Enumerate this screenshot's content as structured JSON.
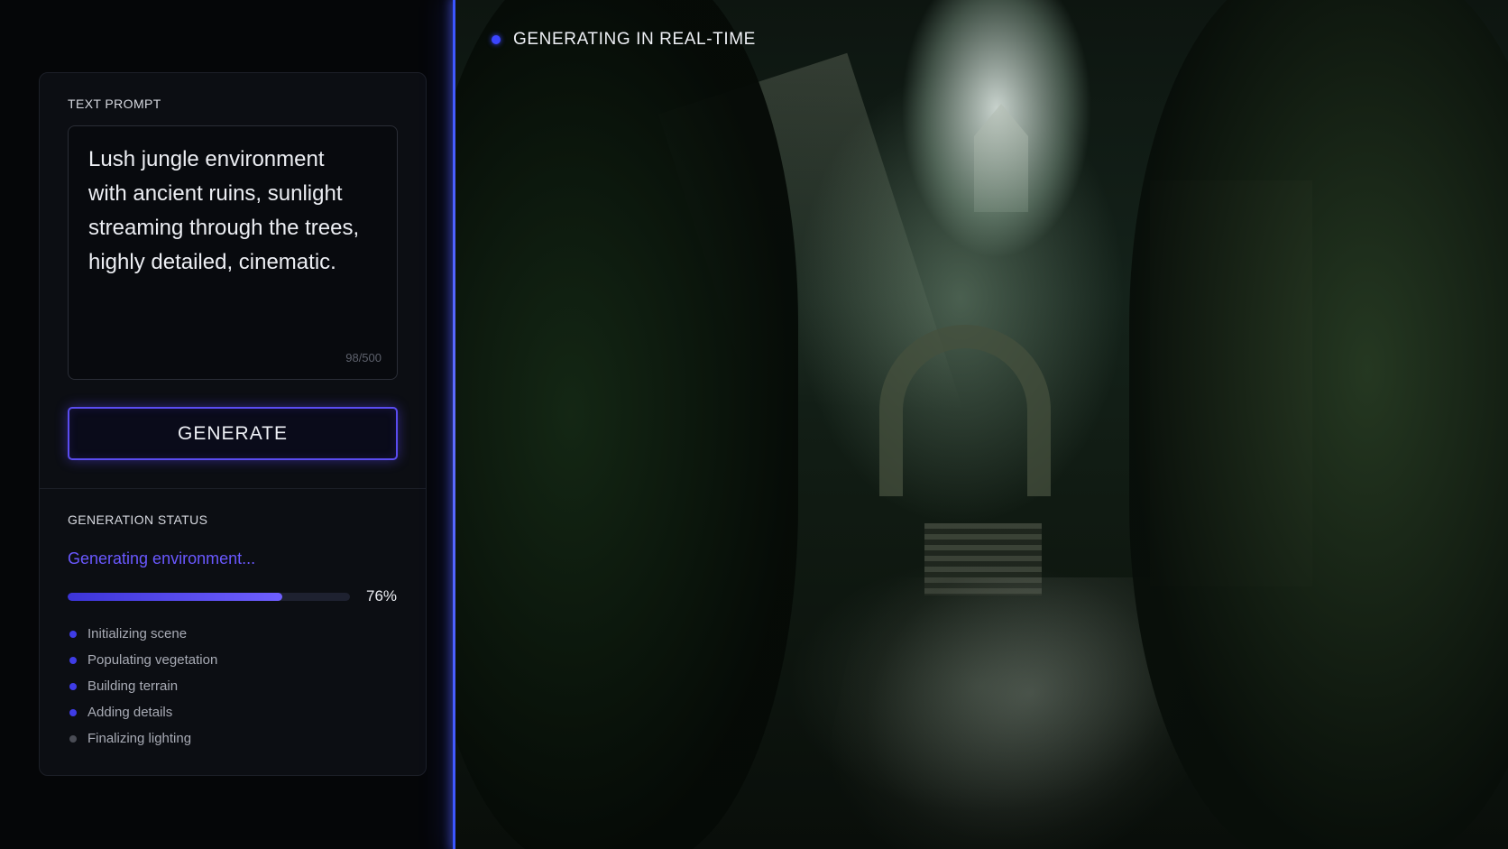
{
  "prompt_section": {
    "label": "TEXT PROMPT",
    "text": "Lush jungle environment with ancient ruins, sunlight streaming through the trees, highly detailed, cinematic.",
    "char_count": "98/500"
  },
  "generate_button": {
    "label": "GENERATE"
  },
  "status_section": {
    "label": "GENERATION STATUS",
    "status_text": "Generating environment...",
    "progress": 0.76,
    "progress_label": "76%",
    "steps": [
      {
        "label": "Initializing scene",
        "state": "done"
      },
      {
        "label": "Populating vegetation",
        "state": "done"
      },
      {
        "label": "Building terrain",
        "state": "done"
      },
      {
        "label": "Adding details",
        "state": "done"
      },
      {
        "label": "Finalizing lighting",
        "state": "pending"
      }
    ]
  },
  "preview": {
    "badge_text": "GENERATING IN REAL-TIME"
  },
  "colors": {
    "accent": "#5a4cf0",
    "status_text": "#6a58ff",
    "glow_line": "#4a5cff"
  }
}
